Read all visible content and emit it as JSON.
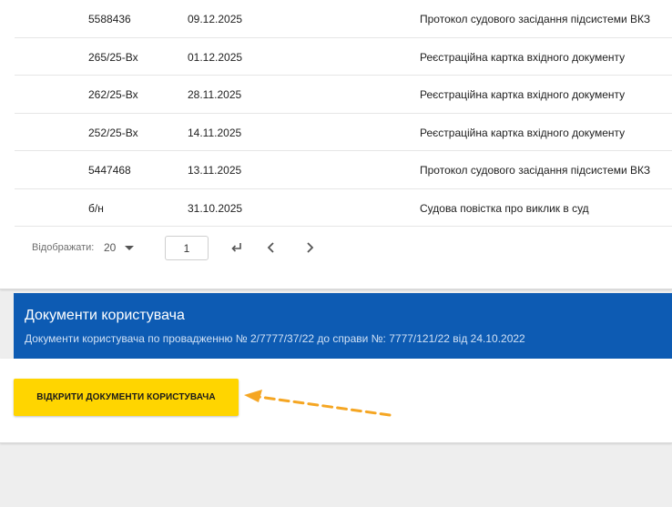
{
  "documents": {
    "rows": [
      {
        "number": "5588436",
        "date": "09.12.2025",
        "title": "Протокол судового засідання підсистеми ВКЗ"
      },
      {
        "number": "265/25-Вх",
        "date": "01.12.2025",
        "title": "Реєстраційна картка вхідного документу"
      },
      {
        "number": "262/25-Вх",
        "date": "28.11.2025",
        "title": "Реєстраційна картка вхідного документу"
      },
      {
        "number": "252/25-Вх",
        "date": "14.11.2025",
        "title": "Реєстраційна картка вхідного документу"
      },
      {
        "number": "5447468",
        "date": "13.11.2025",
        "title": "Протокол судового засідання підсистеми ВКЗ"
      },
      {
        "number": "б/н",
        "date": "31.10.2025",
        "title": "Судова повістка про виклик в суд"
      }
    ]
  },
  "pager": {
    "label": "Відображати:",
    "page_size": "20",
    "page": "1",
    "icons": [
      "enter-return-icon",
      "chevron-left-icon",
      "chevron-right-icon"
    ]
  },
  "user_docs": {
    "title": "Документи користувача",
    "subtitle": "Документи користувача по провадженню № 2/7777/37/22 до справи №: 7777/121/22 від 24.10.2022",
    "open_button": "ВІДКРИТИ ДОКУМЕНТИ КОРИСТУВАЧА"
  },
  "colors": {
    "banner": "#0d5bb3",
    "button": "#ffd500",
    "annotation_arrow": "#f5a623"
  }
}
